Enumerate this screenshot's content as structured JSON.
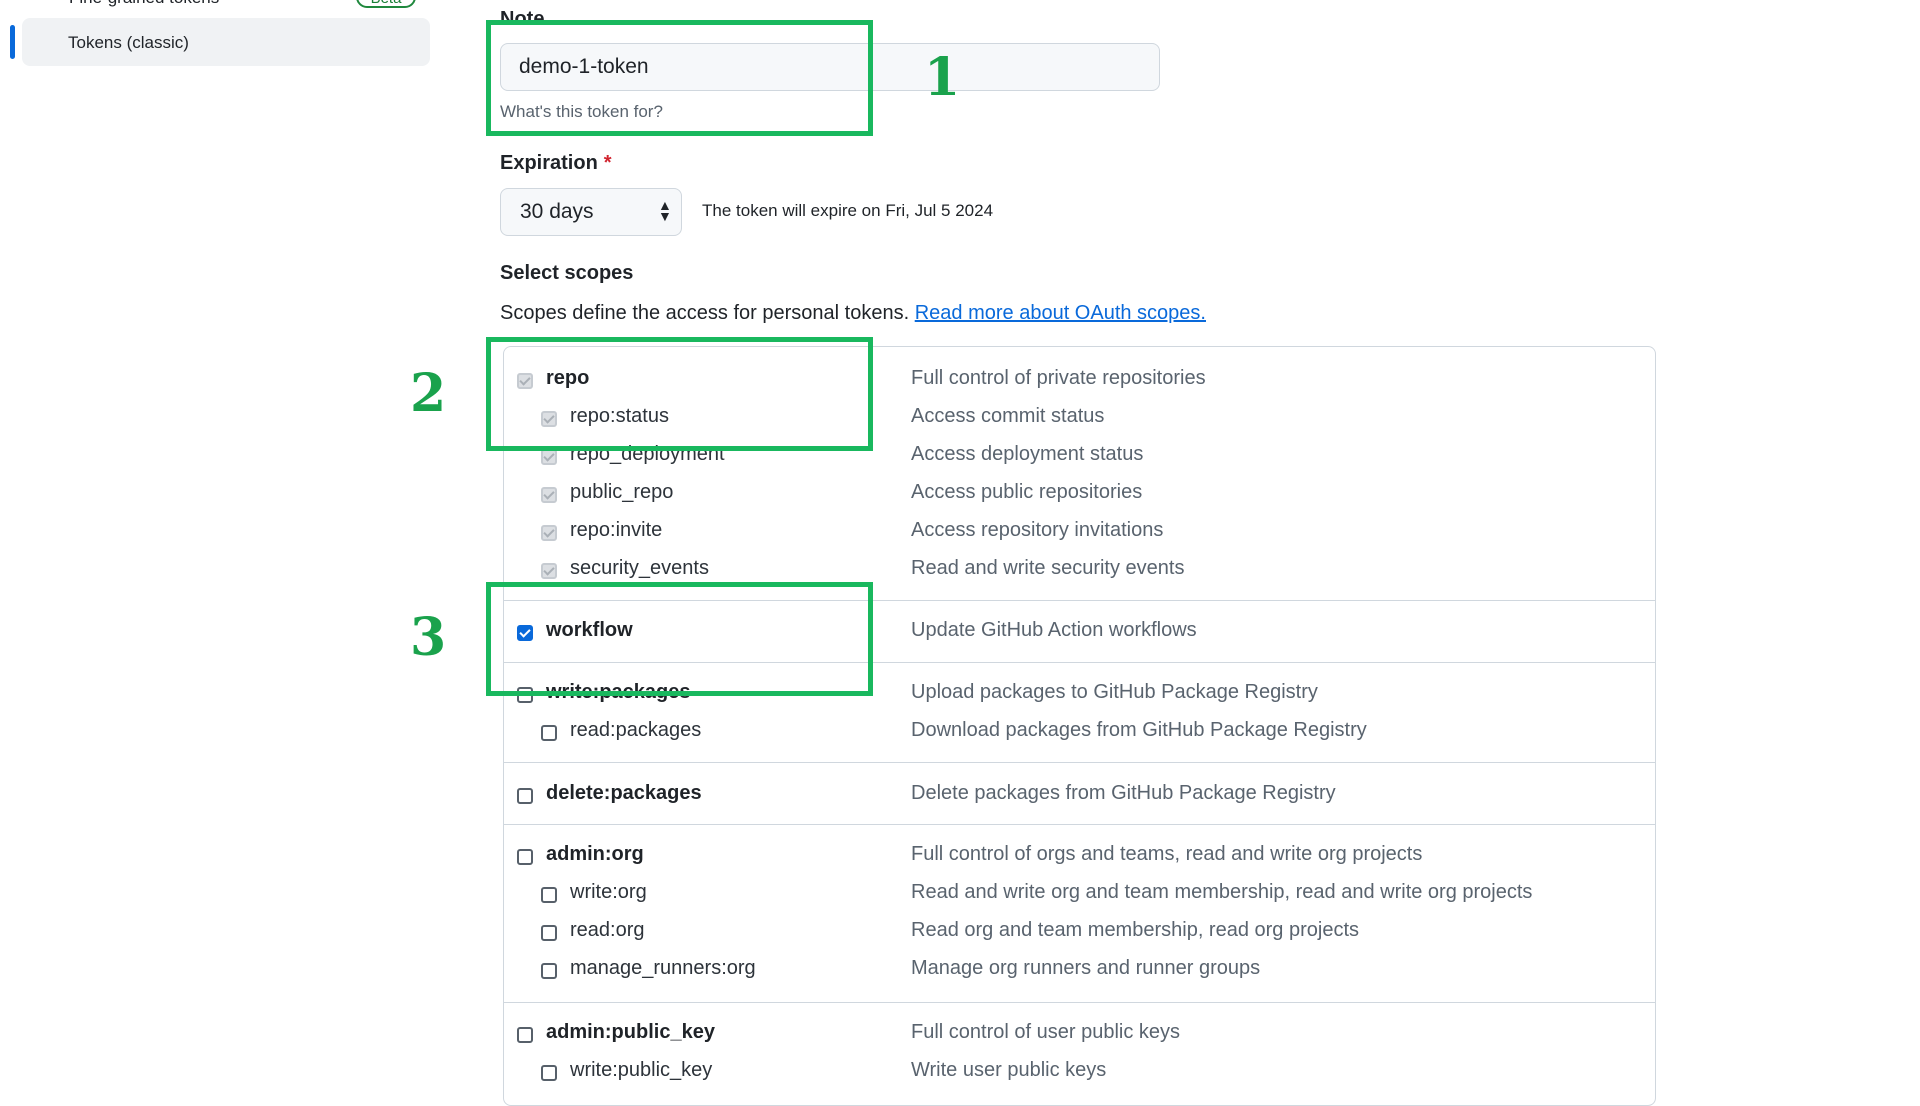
{
  "sidebar": {
    "partial_item_label": "Fine-grained tokens",
    "beta_badge": "Beta",
    "active_item_label": "Tokens (classic)"
  },
  "note": {
    "label": "Note",
    "value": "demo-1-token",
    "help": "What's this token for?"
  },
  "expiration": {
    "label": "Expiration",
    "required_mark": "*",
    "selected": "30 days",
    "expiry_text": "The token will expire on Fri, Jul 5 2024"
  },
  "scopes": {
    "heading": "Select scopes",
    "description": "Scopes define the access for personal tokens.",
    "link_text": "Read more about OAuth scopes.",
    "items": [
      {
        "name": "repo",
        "desc": "Full control of private repositories",
        "state": "disabled-checked"
      },
      {
        "name": "repo:status",
        "desc": "Access commit status",
        "state": "disabled-checked"
      },
      {
        "name": "repo_deployment",
        "desc": "Access deployment status",
        "state": "disabled-checked"
      },
      {
        "name": "public_repo",
        "desc": "Access public repositories",
        "state": "disabled-checked"
      },
      {
        "name": "repo:invite",
        "desc": "Access repository invitations",
        "state": "disabled-checked"
      },
      {
        "name": "security_events",
        "desc": "Read and write security events",
        "state": "disabled-checked"
      },
      {
        "name": "workflow",
        "desc": "Update GitHub Action workflows",
        "state": "checked"
      },
      {
        "name": "write:packages",
        "desc": "Upload packages to GitHub Package Registry",
        "state": "unchecked"
      },
      {
        "name": "read:packages",
        "desc": "Download packages from GitHub Package Registry",
        "state": "unchecked"
      },
      {
        "name": "delete:packages",
        "desc": "Delete packages from GitHub Package Registry",
        "state": "unchecked"
      },
      {
        "name": "admin:org",
        "desc": "Full control of orgs and teams, read and write org projects",
        "state": "unchecked"
      },
      {
        "name": "write:org",
        "desc": "Read and write org and team membership, read and write org projects",
        "state": "unchecked"
      },
      {
        "name": "read:org",
        "desc": "Read org and team membership, read org projects",
        "state": "unchecked"
      },
      {
        "name": "manage_runners:org",
        "desc": "Manage org runners and runner groups",
        "state": "unchecked"
      },
      {
        "name": "admin:public_key",
        "desc": "Full control of user public keys",
        "state": "unchecked"
      },
      {
        "name": "write:public_key",
        "desc": "Write user public keys",
        "state": "unchecked"
      }
    ]
  },
  "annotations": {
    "marker_1": "1",
    "marker_2": "2",
    "marker_3": "3",
    "highlight_color": "#19b85e"
  }
}
